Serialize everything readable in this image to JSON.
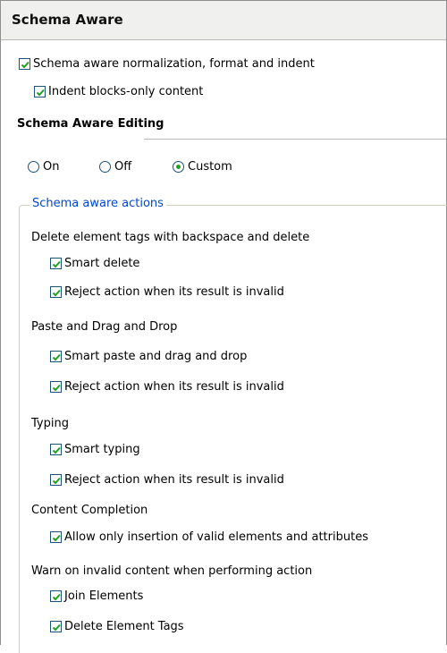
{
  "header": {
    "title": "Schema Aware"
  },
  "options": {
    "normalize": {
      "label": "Schema aware normalization, format and indent",
      "checked": true
    },
    "indent_blocks": {
      "label": "Indent blocks-only content",
      "checked": true
    }
  },
  "editing": {
    "title": "Schema Aware Editing",
    "modes": [
      {
        "label": "On",
        "selected": false
      },
      {
        "label": "Off",
        "selected": false
      },
      {
        "label": "Custom",
        "selected": true
      }
    ]
  },
  "actions": {
    "legend": "Schema aware actions",
    "delete_group": {
      "label": "Delete element tags with backspace and delete",
      "smart_delete": "Smart delete",
      "reject": "Reject action when its result is invalid"
    },
    "paste_group": {
      "label": "Paste and Drag and Drop",
      "smart_paste": "Smart paste and drag and drop",
      "reject": "Reject action when its result is invalid"
    },
    "typing_group": {
      "label": "Typing",
      "smart_typing": "Smart typing",
      "reject": "Reject action when its result is invalid"
    },
    "completion_group": {
      "label": "Content Completion",
      "allow_valid": "Allow only insertion of valid elements and attributes"
    },
    "warn_group": {
      "label": "Warn on invalid content when performing action",
      "join": "Join Elements",
      "delete_tags": "Delete Element Tags"
    }
  },
  "colors": {
    "accent_check": "#21a121",
    "legend": "#0046d5",
    "header_bg": "#f0f0ee"
  }
}
